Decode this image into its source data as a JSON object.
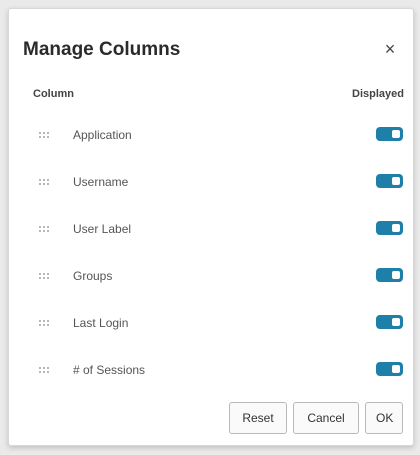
{
  "dialog": {
    "title": "Manage Columns",
    "close_glyph": "×",
    "header_column": "Column",
    "header_displayed": "Displayed"
  },
  "columns": [
    {
      "label": "Application",
      "displayed": true
    },
    {
      "label": "Username",
      "displayed": true
    },
    {
      "label": "User Label",
      "displayed": true
    },
    {
      "label": "Groups",
      "displayed": true
    },
    {
      "label": "Last Login",
      "displayed": true
    },
    {
      "label": "# of Sessions",
      "displayed": true
    }
  ],
  "footer": {
    "reset_label": "Reset",
    "cancel_label": "Cancel",
    "ok_label": "OK"
  },
  "colors": {
    "toggle_on": "#1e7fa8"
  }
}
